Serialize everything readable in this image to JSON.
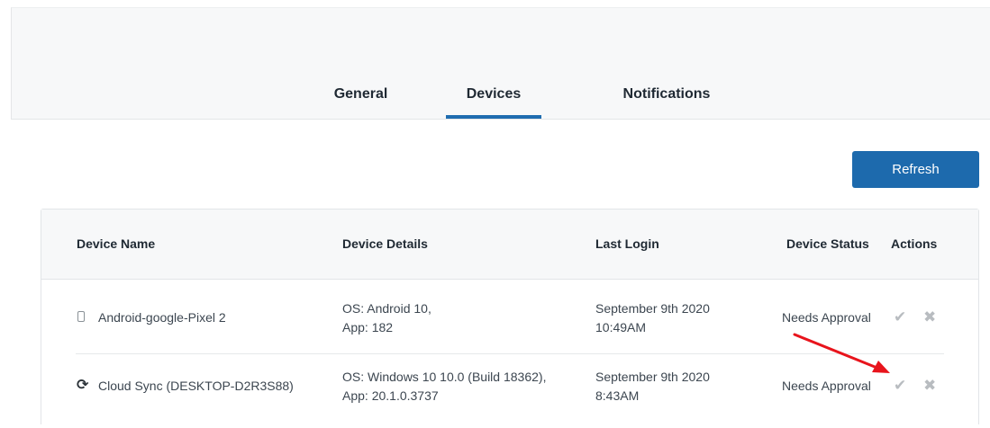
{
  "tabs": {
    "general": "General",
    "devices": "Devices",
    "notifications": "Notifications"
  },
  "refresh_label": "Refresh",
  "table": {
    "headers": {
      "device_name": "Device Name",
      "device_details": "Device Details",
      "last_login": "Last Login",
      "device_status": "Device Status",
      "actions": "Actions"
    },
    "rows": [
      {
        "name": "Android-google-Pixel 2",
        "icon": "phone-icon",
        "details_line1": "OS: Android 10,",
        "details_line2": "App: 182",
        "login_line1": "September 9th 2020",
        "login_line2": "10:49AM",
        "status": "Needs Approval"
      },
      {
        "name": "Cloud Sync (DESKTOP-D2R3S88)",
        "icon": "sync-icon",
        "details_line1": "OS: Windows 10 10.0 (Build 18362),",
        "details_line2": "App: 20.1.0.3737",
        "login_line1": "September 9th 2020",
        "login_line2": "8:43AM",
        "status": "Needs Approval"
      }
    ]
  },
  "colors": {
    "accent": "#1d6aad",
    "annotation_arrow": "#e8141c"
  }
}
